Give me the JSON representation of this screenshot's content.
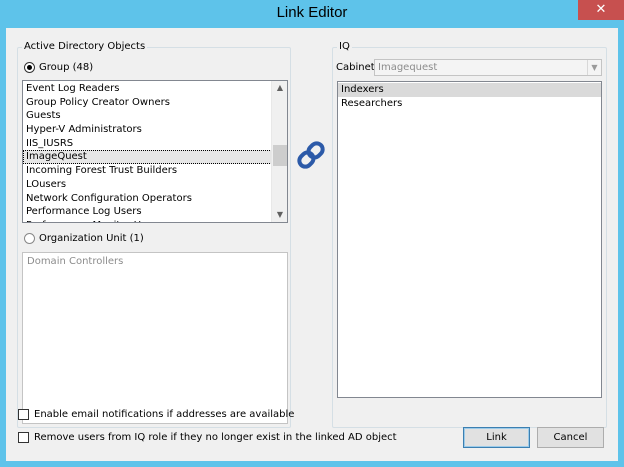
{
  "window": {
    "title": "Link Editor",
    "close_glyph": "✕"
  },
  "ad": {
    "legend": "Active Directory Objects",
    "group_option": "Group (48)",
    "groups": [
      "Event Log Readers",
      "Group Policy Creator Owners",
      "Guests",
      "Hyper-V Administrators",
      "IIS_IUSRS",
      "ImageQuest",
      "Incoming Forest Trust Builders",
      "LOusers",
      "Network Configuration Operators",
      "Performance Log Users",
      "Performance Monitor Users"
    ],
    "selected_group": "ImageQuest",
    "ou_option": "Organization Unit (1)",
    "ou_placeholder": "Domain Controllers"
  },
  "iq": {
    "legend": "IQ",
    "cabinet_label": "Cabinet",
    "cabinet_value": "Imagequest",
    "roles": [
      "Indexers",
      "Researchers"
    ],
    "selected_role": "Indexers"
  },
  "options": {
    "email_notifications": "Enable email notifications if addresses are available",
    "remove_users": "Remove users from IQ role if they no longer exist in the linked AD object"
  },
  "buttons": {
    "link": "Link",
    "cancel": "Cancel"
  },
  "icons": {
    "link": "link-chain-icon",
    "scroll_up": "▲",
    "scroll_down": "▼",
    "dropdown": "▼"
  },
  "colors": {
    "titlebar": "#5ec3ea",
    "close": "#c7504f",
    "accent_link": "#2c5aa8"
  }
}
